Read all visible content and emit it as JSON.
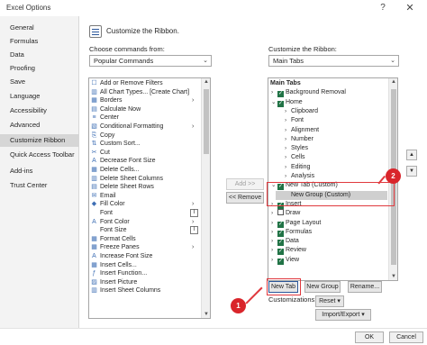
{
  "window": {
    "title": "Excel Options",
    "help_glyph": "?",
    "close_glyph": "✕"
  },
  "nav": {
    "items": [
      {
        "label": "General"
      },
      {
        "label": "Formulas"
      },
      {
        "label": "Data"
      },
      {
        "label": "Proofing"
      },
      {
        "label": "Save"
      },
      {
        "label": "Language"
      },
      {
        "label": "Accessibility"
      },
      {
        "label": "Advanced"
      },
      {
        "label": "Customize Ribbon"
      },
      {
        "label": "Quick Access Toolbar"
      },
      {
        "label": "Add-ins"
      },
      {
        "label": "Trust Center"
      }
    ],
    "selected_index": 8
  },
  "header": {
    "title": "Customize the Ribbon."
  },
  "left": {
    "label": "Choose commands from:",
    "dropdown_value": "Popular Commands",
    "commands": [
      {
        "icon": "☐",
        "label": "Add or Remove Filters"
      },
      {
        "icon": "▥",
        "label": "All Chart Types... [Create Chart]"
      },
      {
        "icon": "▦",
        "label": "Borders",
        "sub": "›"
      },
      {
        "icon": "▤",
        "label": "Calculate Now"
      },
      {
        "icon": "≡",
        "label": "Center"
      },
      {
        "icon": "▧",
        "label": "Conditional Formatting",
        "sub": "›"
      },
      {
        "icon": "⎘",
        "label": "Copy"
      },
      {
        "icon": "⇅",
        "label": "Custom Sort..."
      },
      {
        "icon": "✂",
        "label": "Cut"
      },
      {
        "icon": "A",
        "label": "Decrease Font Size"
      },
      {
        "icon": "▦",
        "label": "Delete Cells..."
      },
      {
        "icon": "▥",
        "label": "Delete Sheet Columns"
      },
      {
        "icon": "▤",
        "label": "Delete Sheet Rows"
      },
      {
        "icon": "✉",
        "label": "Email"
      },
      {
        "icon": "◆",
        "label": "Fill Color",
        "sub": "›"
      },
      {
        "icon": "",
        "label": "Font",
        "subbox": "I"
      },
      {
        "icon": "A",
        "label": "Font Color",
        "sub": "›"
      },
      {
        "icon": "",
        "label": "Font Size",
        "subbox": "I"
      },
      {
        "icon": "▦",
        "label": "Format Cells"
      },
      {
        "icon": "▦",
        "label": "Freeze Panes",
        "sub": "›"
      },
      {
        "icon": "A",
        "label": "Increase Font Size"
      },
      {
        "icon": "▦",
        "label": "Insert Cells..."
      },
      {
        "icon": "ƒ",
        "label": "Insert Function..."
      },
      {
        "icon": "▨",
        "label": "Insert Picture"
      },
      {
        "icon": "▥",
        "label": "Insert Sheet Columns"
      }
    ]
  },
  "middle": {
    "add_label": "Add >>",
    "remove_label": "<< Remove"
  },
  "right": {
    "label": "Customize the Ribbon:",
    "dropdown_value": "Main Tabs",
    "tree": [
      {
        "text": "Main Tabs",
        "level": 0,
        "bold": true
      },
      {
        "text": "Background Removal",
        "level": 1,
        "expander": "›",
        "checked": true
      },
      {
        "text": "Home",
        "level": 1,
        "expander": "⌄",
        "checked": true
      },
      {
        "text": "Clipboard",
        "level": 2,
        "expander": "›"
      },
      {
        "text": "Font",
        "level": 2,
        "expander": "›"
      },
      {
        "text": "Alignment",
        "level": 2,
        "expander": "›"
      },
      {
        "text": "Number",
        "level": 2,
        "expander": "›"
      },
      {
        "text": "Styles",
        "level": 2,
        "expander": "›"
      },
      {
        "text": "Cells",
        "level": 2,
        "expander": "›"
      },
      {
        "text": "Editing",
        "level": 2,
        "expander": "›"
      },
      {
        "text": "Analysis",
        "level": 2,
        "expander": "›"
      },
      {
        "text": "New Tab (Custom)",
        "level": 1,
        "expander": "⌄",
        "checked": true
      },
      {
        "text": "New Group (Custom)",
        "level": 2,
        "expander": "",
        "selected": true
      },
      {
        "text": "Insert",
        "level": 1,
        "expander": "›",
        "checked": true
      },
      {
        "text": "Draw",
        "level": 1,
        "expander": "›",
        "checked": false
      },
      {
        "text": "Page Layout",
        "level": 1,
        "expander": "›",
        "checked": true
      },
      {
        "text": "Formulas",
        "level": 1,
        "expander": "›",
        "checked": true
      },
      {
        "text": "Data",
        "level": 1,
        "expander": "›",
        "checked": true
      },
      {
        "text": "Review",
        "level": 1,
        "expander": "›",
        "checked": true
      },
      {
        "text": "View",
        "level": 1,
        "expander": "›",
        "checked": true
      }
    ],
    "new_tab_label": "New Tab",
    "new_group_label": "New Group",
    "rename_label": "Rename...",
    "customizations_label": "Customizations:",
    "reset_label": "Reset ▾",
    "import_export_label": "Import/Export ▾"
  },
  "callouts": {
    "one": "1",
    "two": "2"
  },
  "footer": {
    "ok_label": "OK",
    "cancel_label": "Cancel"
  },
  "colors": {
    "accent": "#217346",
    "highlight": "#e0393e",
    "selected_nav": "#d6d6d6"
  }
}
